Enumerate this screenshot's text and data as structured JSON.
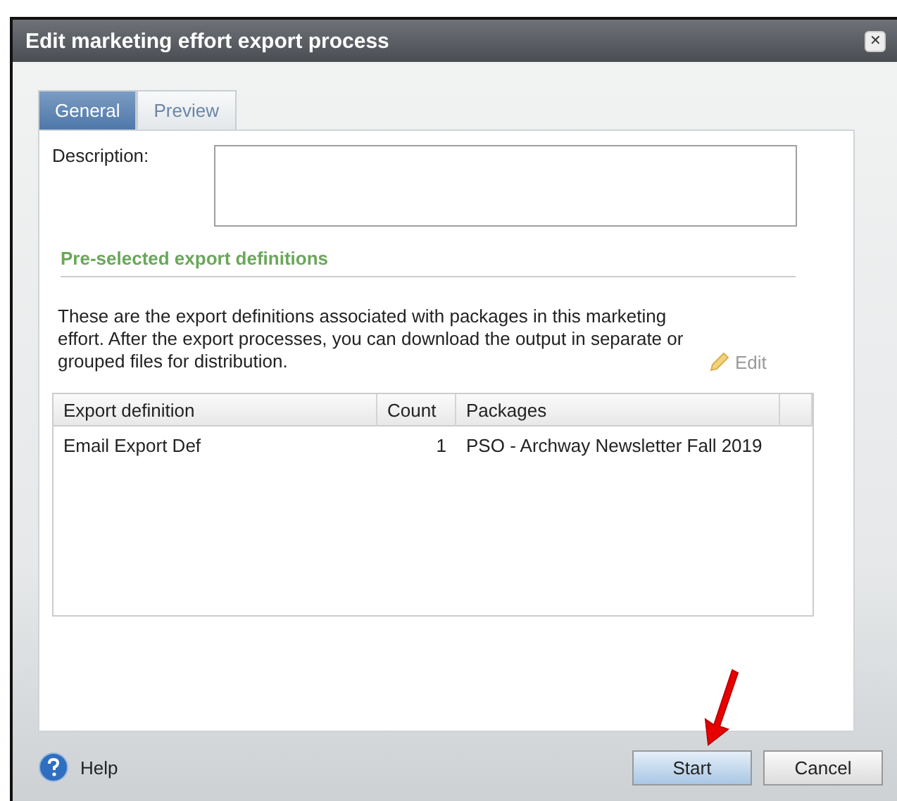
{
  "window": {
    "title": "Edit marketing effort export process",
    "close": "✕"
  },
  "tabs": [
    {
      "label": "General",
      "selected": true
    },
    {
      "label": "Preview",
      "selected": false
    }
  ],
  "description": {
    "label": "Description:"
  },
  "section": {
    "title": "Pre-selected export definitions",
    "text": "These are the export definitions associated with packages in this marketing effort. After the export processes, you can download the output in separate or grouped files for distribution.",
    "edit": {
      "label": "Edit",
      "disabled": true
    }
  },
  "table": {
    "columns": [
      "Export definition",
      "Count",
      "Packages"
    ],
    "rows": [
      [
        "Email Export Def",
        "1",
        "PSO - Archway Newsletter Fall 2019"
      ]
    ]
  },
  "footer": {
    "help": "Help",
    "buttons": [
      {
        "label": "Start",
        "selected": true
      },
      {
        "label": "Cancel",
        "selected": false
      }
    ]
  }
}
